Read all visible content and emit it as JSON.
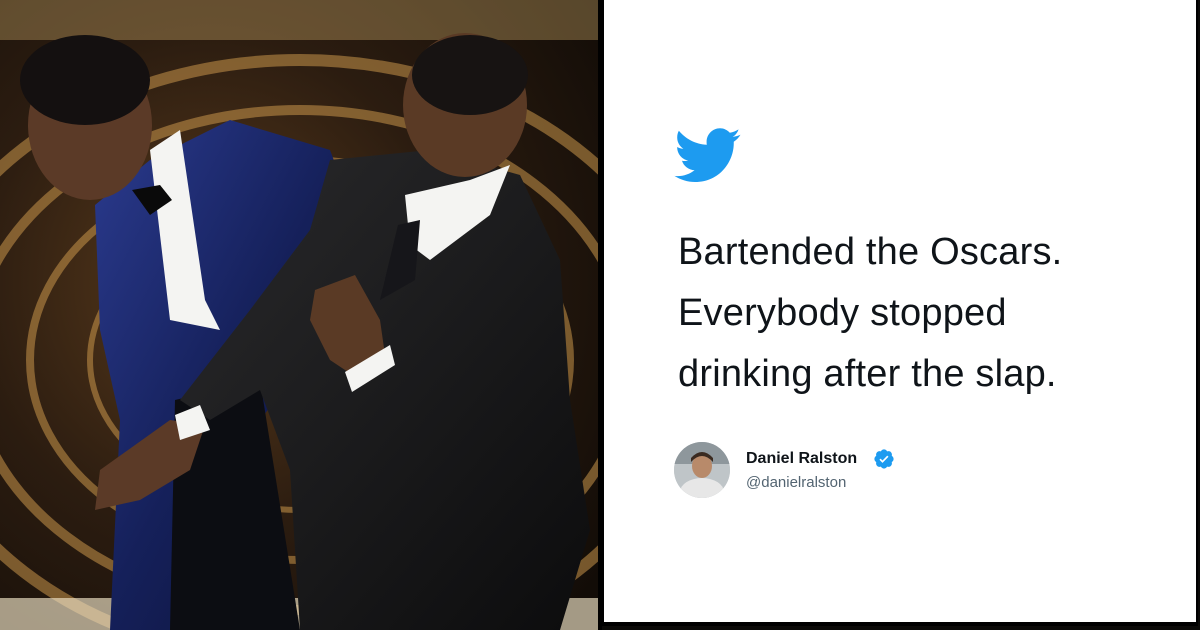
{
  "tweet": {
    "lines": [
      "Bartended the Oscars.",
      "Everybody stopped",
      "drinking after the slap."
    ],
    "author_name": "Daniel Ralston",
    "author_handle": "@danielralston",
    "brand_color": "#1d9bf0",
    "verified": true
  },
  "icons": {
    "brand": "twitter-bird-icon",
    "verified": "verified-badge-icon"
  },
  "photo": {
    "subject": "two men in tuxedos on stage"
  }
}
